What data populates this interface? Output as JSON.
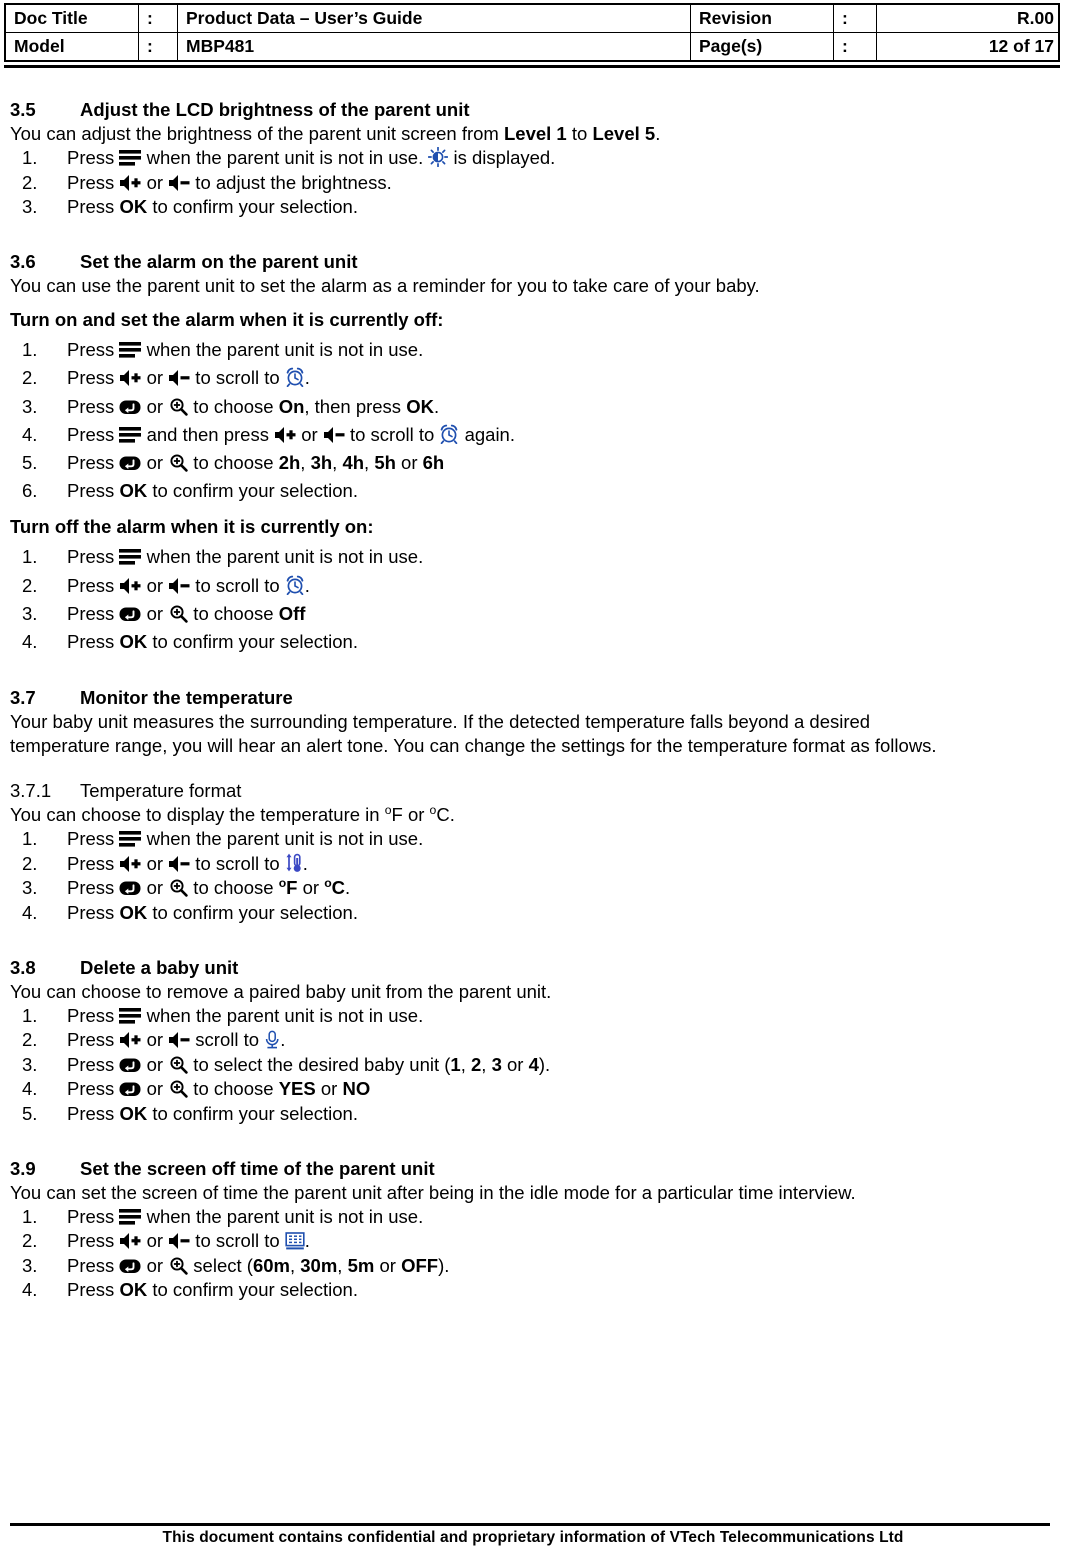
{
  "header": {
    "rows": [
      {
        "label": "Doc Title",
        "colon": ":",
        "value": "Product Data – User’s Guide",
        "label2": "Revision",
        "colon2": ":",
        "value2": "R.00"
      },
      {
        "label": "Model",
        "colon": ":",
        "value": "MBP481",
        "label2": "Page(s)",
        "colon2": ":",
        "value2": "12 of 17"
      }
    ]
  },
  "sections": {
    "s35": {
      "number": "3.5",
      "title": "Adjust the LCD brightness of the parent unit",
      "intro_a": "You can adjust the brightness of the parent unit screen from ",
      "intro_b": "Level 1",
      "intro_c": " to ",
      "intro_d": "Level 5",
      "intro_e": ".",
      "steps": [
        {
          "a": "Press ",
          "b": " when the parent unit is not in use. ",
          "c": " is displayed."
        },
        {
          "a": "Press ",
          "b": " or ",
          "c": " to adjust the brightness."
        },
        {
          "a": "Press ",
          "bold": "OK",
          "b": " to confirm your selection."
        }
      ]
    },
    "s36": {
      "number": "3.6",
      "title": "Set the alarm on the parent unit",
      "intro": "You can use the parent unit to set the alarm as a reminder for you to take care of your baby.",
      "sub_on": "Turn on and set the alarm when it is currently off:",
      "steps_on": [
        {
          "a": "Press ",
          "b": " when the parent unit is not in use."
        },
        {
          "a": "Press ",
          "b": " or ",
          "c": " to scroll to ",
          "d": "."
        },
        {
          "a": "Press ",
          "b": " or ",
          "c": " to choose ",
          "bold1": "On",
          "d": ", then press ",
          "bold2": "OK",
          "e": "."
        },
        {
          "a": "Press ",
          "b": " and then press ",
          "c": " or ",
          "d": " to scroll to ",
          "e": " again."
        },
        {
          "a": "Press ",
          "b": " or ",
          "c": " to choose ",
          "b1": "2h",
          "s1": ", ",
          "b2": "3h",
          "s2": ", ",
          "b3": "4h",
          "s3": ", ",
          "b4": "5h",
          "s4": " or ",
          "b5": "6h"
        },
        {
          "a": "Press ",
          "bold": "OK",
          "b": " to confirm your selection."
        }
      ],
      "sub_off": "Turn off the alarm when it is currently on:",
      "steps_off": [
        {
          "a": "Press ",
          "b": " when the parent unit is not in use."
        },
        {
          "a": "Press ",
          "b": " or ",
          "c": " to scroll to ",
          "d": "."
        },
        {
          "a": "Press ",
          "b": " or ",
          "c": " to choose ",
          "bold": "Off"
        },
        {
          "a": "Press ",
          "bold": "OK",
          "b": " to confirm your selection."
        }
      ]
    },
    "s37": {
      "number": "3.7",
      "title": "Monitor the temperature",
      "intro_line1": "Your baby unit measures the surrounding temperature. If the detected temperature falls beyond a desired",
      "intro_line2": "temperature range, you will hear an alert tone. You can change the settings for the temperature format as follows.",
      "sub_number": "3.7.1",
      "sub_title": "Temperature format",
      "sub_intro_a": "You can choose to display the temperature in ",
      "sub_intro_deg1": "o",
      "sub_intro_b": "F or ",
      "sub_intro_deg2": "o",
      "sub_intro_c": "C.",
      "steps": [
        {
          "a": "Press ",
          "b": " when the parent unit is not in use."
        },
        {
          "a": "Press ",
          "b": " or ",
          "c": " to scroll to ",
          "d": "."
        },
        {
          "a": "Press ",
          "b": " or ",
          "c": " to choose ",
          "deg1": "o",
          "boldF": "F",
          "mid": " or ",
          "deg2": "o",
          "boldC": "C",
          "end": "."
        },
        {
          "a": "Press ",
          "bold": "OK",
          "b": " to confirm your selection."
        }
      ]
    },
    "s38": {
      "number": "3.8",
      "title": "Delete a baby unit",
      "intro": "You can choose to remove a paired baby unit from the parent unit.",
      "steps": [
        {
          "a": "Press ",
          "b": " when the parent unit is not in use."
        },
        {
          "a": "Press ",
          "b": " or ",
          "c": " scroll to ",
          "d": "."
        },
        {
          "a": "Press ",
          "b": " or ",
          "c": " to select the desired baby unit (",
          "b1": "1",
          "s1": ", ",
          "b2": "2",
          "s2": ", ",
          "b3": "3",
          "s3": " or ",
          "b4": "4",
          "end": ")."
        },
        {
          "a": "Press ",
          "b": " or ",
          "c": " to choose ",
          "b1": "YES",
          "s1": " or ",
          "b2": "NO"
        },
        {
          "a": "Press ",
          "bold": "OK",
          "b": " to confirm your selection."
        }
      ]
    },
    "s39": {
      "number": "3.9",
      "title": "Set the screen off time of the parent unit",
      "intro": "You can set the screen of time the parent unit after being in the idle mode for a particular time interview.",
      "steps": [
        {
          "a": "Press ",
          "b": " when the parent unit is not in use."
        },
        {
          "a": "Press ",
          "b": " or ",
          "c": " to scroll to ",
          "d": "."
        },
        {
          "a": "Press ",
          "b": " or ",
          "c": " select (",
          "b1": "60m",
          "s1": ", ",
          "b2": "30m",
          "s2": ", ",
          "b3": "5m",
          "s3": " or ",
          "b4": "OFF",
          "end": ")."
        },
        {
          "a": "Press ",
          "bold": "OK",
          "b": " to confirm your selection."
        }
      ]
    }
  },
  "footer": {
    "text": "This document contains confidential and proprietary information of VTech Telecommunications Ltd"
  },
  "icons": {
    "menu": "menu-icon",
    "volume_up": "volume-up-icon",
    "volume_down": "volume-down-icon",
    "brightness": "brightness-icon",
    "alarm_clock": "alarm-clock-icon",
    "back": "back-icon",
    "zoom_in": "zoom-in-icon",
    "thermometer": "thermometer-icon",
    "baby_unit": "baby-unit-icon",
    "screen_off": "screen-off-icon"
  },
  "colors": {
    "icon_blue": "#1F4FAF",
    "icon_black": "#000000",
    "text": "#000000"
  }
}
